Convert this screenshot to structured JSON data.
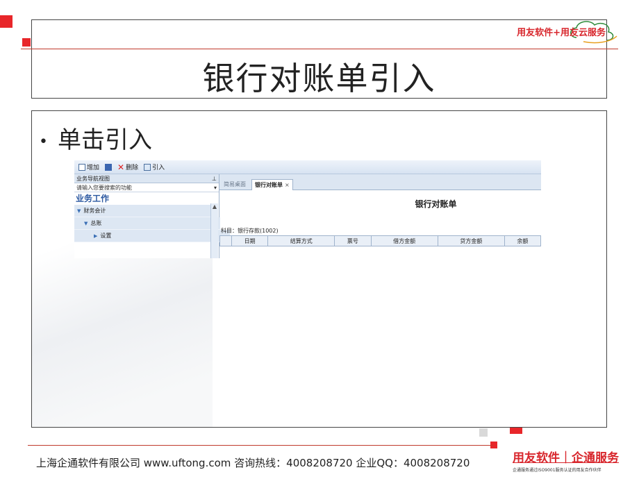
{
  "slide": {
    "title": "银行对账单引入",
    "bullet": "单击引入",
    "brand_top": "用友软件+用友云服务",
    "footer_text": "上海企通软件有限公司 www.uftong.com 咨询热线：4008208720 企业QQ：4008208720",
    "footer_brand": "用友软件｜企通服务",
    "footer_brand_sub": "企通服务通过ISO9001服务认证的用友合作伙伴"
  },
  "app": {
    "toolbar": {
      "add": "增加",
      "delete": "删除",
      "import": "引入"
    },
    "left_pane": {
      "header": "业务导航视图",
      "pin_icon": "pin-icon",
      "search_placeholder": "请输入您要搜索的功能",
      "section": "业务工作",
      "tree": [
        {
          "label": "财务会计",
          "icon": "triangle-down-icon"
        },
        {
          "label": "总账",
          "icon": "triangle-down-icon"
        },
        {
          "label": "设置",
          "icon": "triangle-right-icon"
        }
      ]
    },
    "tabs": [
      {
        "label": "简易桌面"
      },
      {
        "label": "银行对账单",
        "close": "×"
      }
    ],
    "document": {
      "title": "银行对账单",
      "subject": "科目：银行存款(1002)",
      "columns": [
        "日期",
        "结算方式",
        "票号",
        "借方金额",
        "贷方金额",
        "余额"
      ]
    }
  },
  "colors": {
    "accent_red": "#e8262a",
    "brand_red": "#d8262c",
    "nav_blue": "#2a57a0",
    "pane_bg": "#dce6f2"
  }
}
